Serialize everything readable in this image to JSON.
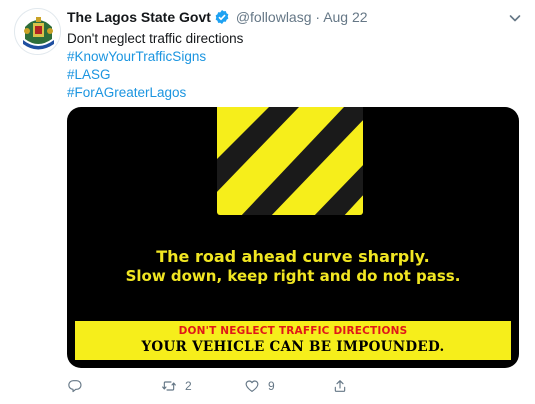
{
  "tweet": {
    "author_name": "The Lagos State Govt",
    "handle": "@followlasg",
    "separator": "·",
    "date": "Aug 22",
    "text": "Don't neglect traffic directions",
    "hashtags": [
      "#KnowYourTrafficSigns",
      "#LASG",
      "#ForAGreaterLagos"
    ],
    "verified": true
  },
  "media": {
    "caption_line1": "The road ahead curve sharply.",
    "caption_line2": "Slow down, keep right and do not pass.",
    "band_top": "DON'T NEGLECT  TRAFFIC DIRECTIONS",
    "band_bottom": "YOUR VEHICLE CAN BE IMPOUNDED.",
    "colors": {
      "sign_yellow": "#f6ee1b",
      "caption_yellow": "#f1e622",
      "warning_red": "#e01818",
      "background": "#000000"
    }
  },
  "actions": {
    "reply_count": "",
    "retweet_count": "2",
    "like_count": "9",
    "share_count": ""
  },
  "icons": [
    "lagos-crest-icon",
    "verified-badge-icon",
    "chevron-down-icon",
    "reply-icon",
    "retweet-icon",
    "like-icon",
    "share-icon"
  ]
}
